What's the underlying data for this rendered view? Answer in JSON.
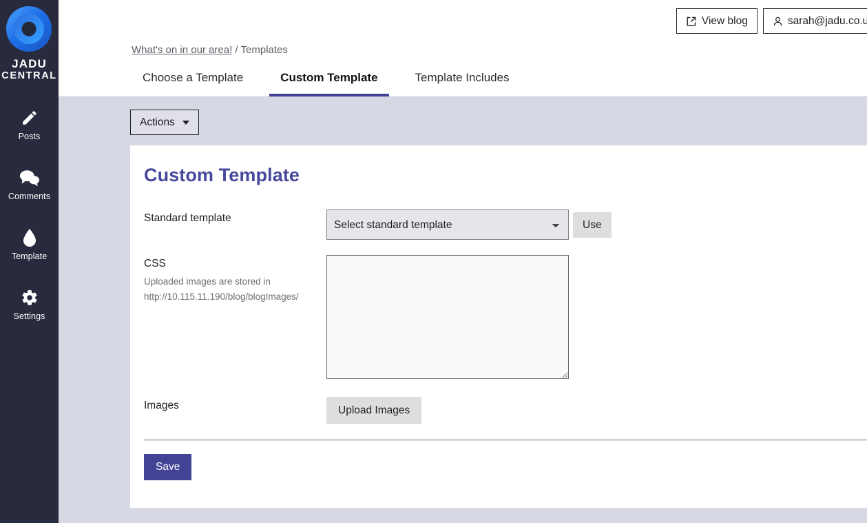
{
  "brand": {
    "name_line1": "JADU",
    "name_line2": "CENTRAL",
    "logo_icon": "jadu-ring-logo",
    "logo_color_outer": "#2f7df6",
    "logo_color_inner": "#1d2233"
  },
  "sidebar": {
    "background": "#272b3d",
    "items": [
      {
        "label": "Posts",
        "icon": "pencil-icon"
      },
      {
        "label": "Comments",
        "icon": "comments-icon"
      },
      {
        "label": "Template",
        "icon": "droplet-icon"
      },
      {
        "label": "Settings",
        "icon": "gear-icon"
      }
    ]
  },
  "header": {
    "view_blog_label": "View blog",
    "view_blog_icon": "external-link-icon",
    "account_label": "sarah@jadu.co.uk",
    "account_icon": "user-icon",
    "account_caret_icon": "caret-down-icon"
  },
  "breadcrumb": {
    "link_label": "What's on in our area!",
    "separator": "/",
    "current_label": "Templates"
  },
  "tabs": [
    {
      "label": "Choose a Template",
      "active": false
    },
    {
      "label": "Custom Template",
      "active": true
    },
    {
      "label": "Template Includes",
      "active": false
    }
  ],
  "toolbar": {
    "actions_label": "Actions",
    "actions_caret_icon": "caret-down-icon"
  },
  "main": {
    "title": "Custom Template",
    "title_color": "#474a9c",
    "fields": {
      "standard_template": {
        "label": "Standard template",
        "select_value": "Select standard template",
        "use_label": "Use"
      },
      "css": {
        "label": "CSS",
        "help_line1": "Uploaded images are stored in",
        "help_line2": "http://10.115.11.190/blog/blogImages/",
        "value": "",
        "placeholder": ""
      },
      "images": {
        "label": "Images",
        "upload_label": "Upload Images"
      }
    },
    "save_label": "Save",
    "save_color": "#424395"
  }
}
